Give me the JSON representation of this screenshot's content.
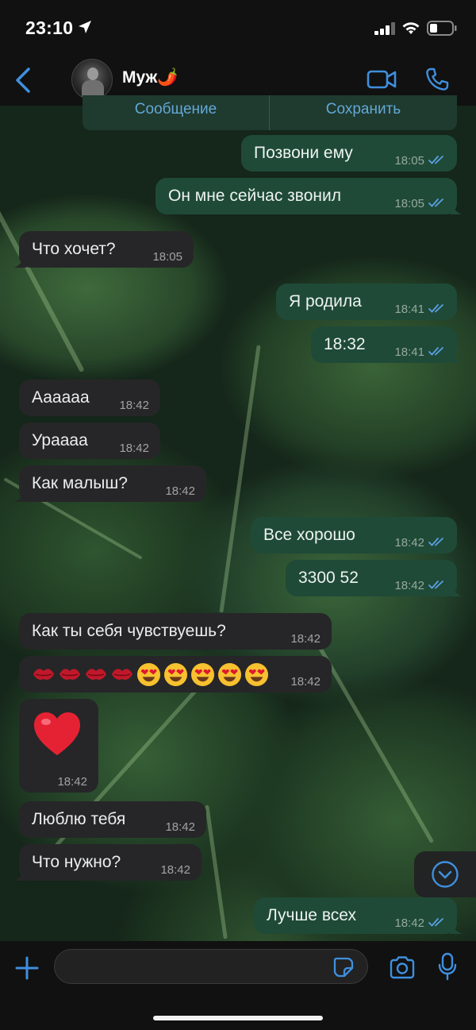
{
  "status_bar": {
    "time": "23:10"
  },
  "header": {
    "contact_name": "Муж🌶️"
  },
  "banner": {
    "left_label": "Сообщение",
    "right_label": "Сохранить"
  },
  "messages": [
    {
      "dir": "out",
      "text": "Позвони ему",
      "time": "18:05"
    },
    {
      "dir": "out",
      "text": "Он мне сейчас звонил",
      "time": "18:05"
    },
    {
      "dir": "in",
      "text": "Что хочет?",
      "time": "18:05"
    },
    {
      "dir": "out",
      "text": "Я родила",
      "time": "18:41"
    },
    {
      "dir": "out",
      "text": "18:32",
      "time": "18:41"
    },
    {
      "dir": "in",
      "text": "Аааааа",
      "time": "18:42"
    },
    {
      "dir": "in",
      "text": "Ураааа",
      "time": "18:42"
    },
    {
      "dir": "in",
      "text": "Как малыш?",
      "time": "18:42"
    },
    {
      "dir": "out",
      "text": "Все хорошо",
      "time": "18:42"
    },
    {
      "dir": "out",
      "text": "3300 52",
      "time": "18:42"
    },
    {
      "dir": "in",
      "text": "Как ты себя чувствуешь?",
      "time": "18:42"
    },
    {
      "dir": "in",
      "emoji": [
        "kiss-mark",
        "kiss-mark",
        "kiss-mark",
        "kiss-mark",
        "heart-eyes",
        "heart-eyes",
        "heart-eyes",
        "heart-eyes",
        "heart-eyes"
      ],
      "time": "18:42"
    },
    {
      "dir": "in",
      "emoji": [
        "red-heart"
      ],
      "time": "18:42"
    },
    {
      "dir": "in",
      "text": "Люблю тебя",
      "time": "18:42"
    },
    {
      "dir": "in",
      "text": "Что нужно?",
      "time": "18:42"
    },
    {
      "dir": "out",
      "text": "Лучше всех",
      "time": "18:42"
    }
  ],
  "input": {
    "value": "",
    "placeholder": ""
  },
  "colors": {
    "accent": "#3f8fde",
    "outgoing_bubble": "#1f4a37",
    "incoming_bubble": "#262628",
    "read_ticks": "#5aa0e6"
  },
  "icons": [
    "location-arrow-icon",
    "signal-icon",
    "wifi-icon",
    "battery-icon",
    "back-chevron-icon",
    "video-call-icon",
    "phone-call-icon",
    "read-ticks-icon",
    "scroll-down-icon",
    "plus-icon",
    "sticker-icon",
    "camera-icon",
    "microphone-icon"
  ]
}
